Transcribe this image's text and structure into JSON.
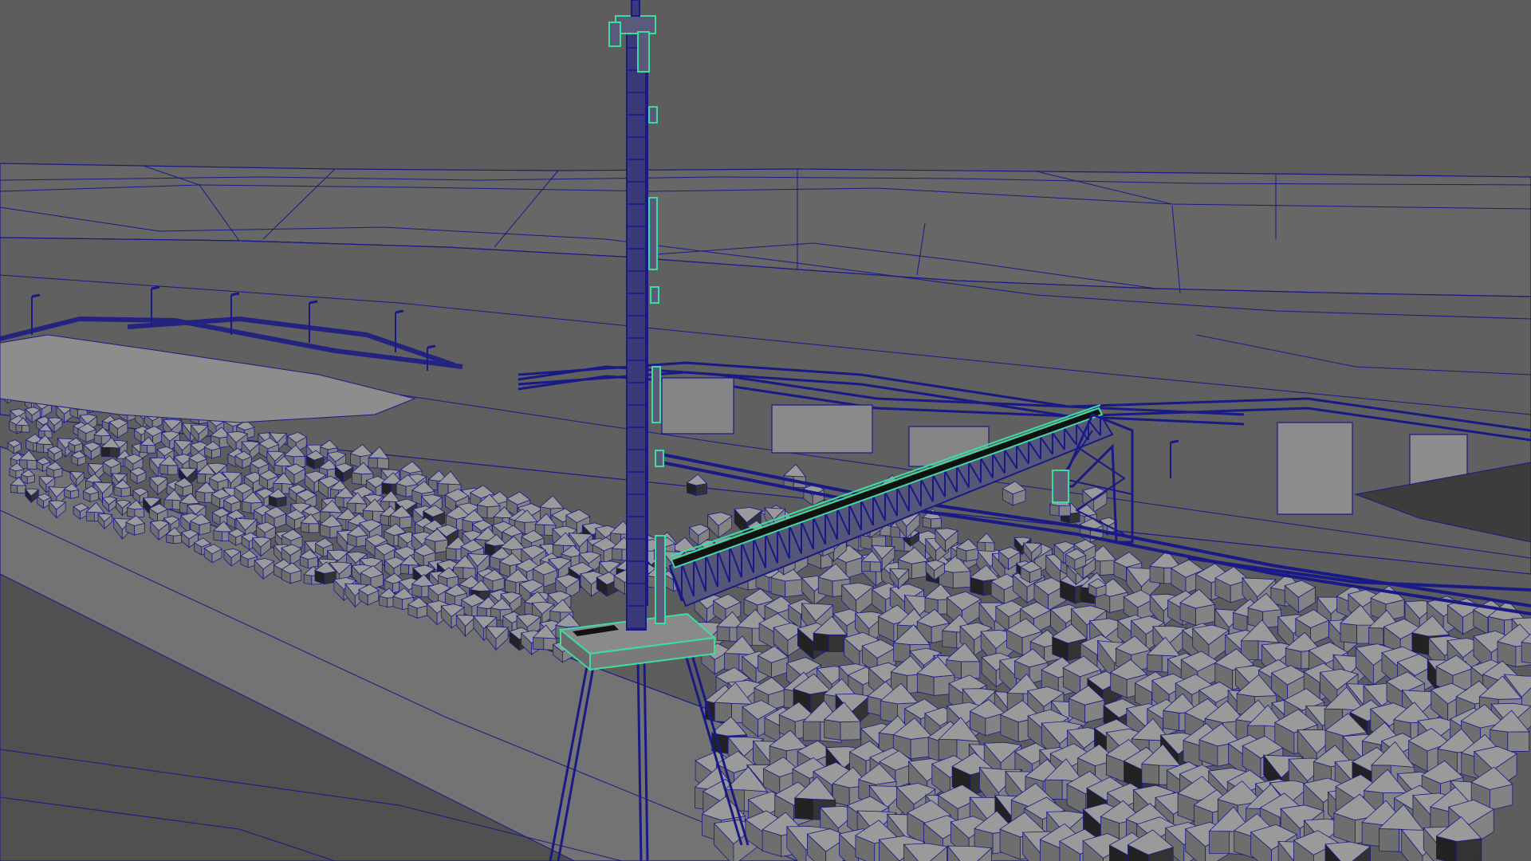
{
  "viewport": {
    "panel": "perspective",
    "display_mode": "wireframe-on-shaded",
    "grid_visible": false,
    "hud_visible": false
  },
  "colors": {
    "background": "#5d5d5d",
    "terrain_far": "#666666",
    "terrain_mid": "#6c6c6c",
    "ground_near": "#585858",
    "embankment": "#747474",
    "cube_top": "#9a9a9a",
    "cube_left": "#6e6e6e",
    "cube_right": "#838383",
    "wireframe": "#1a1a86",
    "selection": "#3fdca0"
  },
  "scene": {
    "objects": [
      {
        "name": "terrain",
        "selected": false
      },
      {
        "name": "breakwater-rock-cubes",
        "selected": false
      },
      {
        "name": "conveyor-trestles",
        "selected": false
      },
      {
        "name": "silo-buildings",
        "selected": false
      },
      {
        "name": "light-poles",
        "selected": false
      },
      {
        "name": "lighting-mast-tower",
        "selected": true
      },
      {
        "name": "shiploader-boom",
        "selected": true
      }
    ]
  }
}
